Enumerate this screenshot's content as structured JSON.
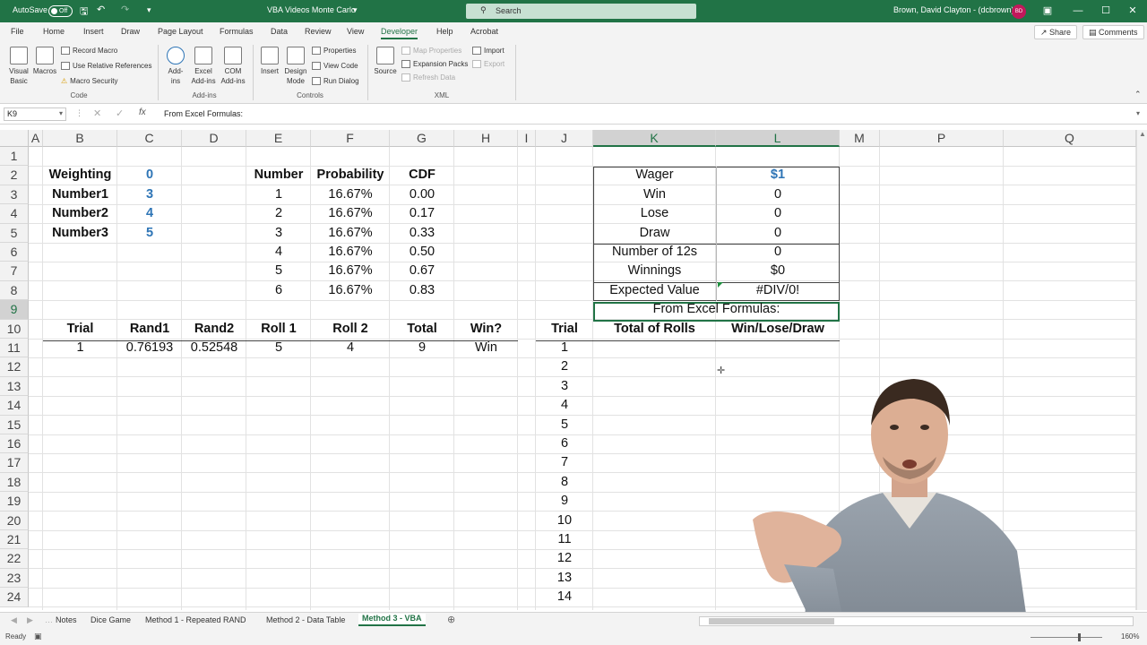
{
  "titlebar": {
    "autosave_label": "AutoSave",
    "autosave_state": "Off",
    "file_title": "VBA Videos Monte Carlo",
    "search_placeholder": "Search",
    "user_name": "Brown, David Clayton - (dcbrown)",
    "user_initials": "BD"
  },
  "menu": {
    "tabs": [
      "File",
      "Home",
      "Insert",
      "Draw",
      "Page Layout",
      "Formulas",
      "Data",
      "Review",
      "View",
      "Developer",
      "Help",
      "Acrobat"
    ],
    "active_tab": "Developer",
    "share_label": "Share",
    "comments_label": "Comments"
  },
  "ribbon": {
    "code": {
      "group_label": "Code",
      "visual_basic": "Visual Basic",
      "macros": "Macros",
      "record_macro": "Record Macro",
      "relative_refs": "Use Relative References",
      "macro_security": "Macro Security"
    },
    "addins": {
      "group_label": "Add-ins",
      "addins": "Add-ins",
      "excel_addins": "Excel Add-ins",
      "com_addins": "COM Add-ins"
    },
    "controls": {
      "group_label": "Controls",
      "insert": "Insert",
      "design_mode": "Design Mode",
      "properties": "Properties",
      "view_code": "View Code",
      "run_dialog": "Run Dialog"
    },
    "xml": {
      "group_label": "XML",
      "source": "Source",
      "map_properties": "Map Properties",
      "expansion_packs": "Expansion Packs",
      "refresh_data": "Refresh Data",
      "import": "Import",
      "export": "Export"
    }
  },
  "formula_bar": {
    "name_box": "K9",
    "fx": "fx",
    "value": "From Excel Formulas:"
  },
  "columns": [
    "A",
    "B",
    "C",
    "D",
    "E",
    "F",
    "G",
    "H",
    "I",
    "J",
    "K",
    "L",
    "M",
    "P",
    "Q"
  ],
  "rows": [
    "1",
    "2",
    "3",
    "4",
    "5",
    "6",
    "7",
    "8",
    "9",
    "10",
    "11",
    "12",
    "13",
    "14",
    "15",
    "16",
    "17",
    "18",
    "19",
    "20",
    "21",
    "22",
    "23",
    "24"
  ],
  "cells": {
    "B2": "Weighting",
    "C2": "0",
    "B3": "Number1",
    "C3": "3",
    "B4": "Number2",
    "C4": "4",
    "B5": "Number3",
    "C5": "5",
    "E2": "Number",
    "F2": "Probability",
    "G2": "CDF",
    "E3": "1",
    "F3": "16.67%",
    "G3": "0.00",
    "E4": "2",
    "F4": "16.67%",
    "G4": "0.17",
    "E5": "3",
    "F5": "16.67%",
    "G5": "0.33",
    "E6": "4",
    "F6": "16.67%",
    "G6": "0.50",
    "E7": "5",
    "F7": "16.67%",
    "G7": "0.67",
    "E8": "6",
    "F8": "16.67%",
    "G8": "0.83",
    "K2": "Wager",
    "L2": "$1",
    "K3": "Win",
    "L3": "0",
    "K4": "Lose",
    "L4": "0",
    "K5": "Draw",
    "L5": "0",
    "K6": "Number of 12s",
    "L6": "0",
    "K7": "Winnings",
    "L7": "$0",
    "K8": "Expected Value",
    "L8": "#DIV/0!",
    "K9": "From Excel Formulas:",
    "B10": "Trial",
    "C10": "Rand1",
    "D10": "Rand2",
    "E10": "Roll 1",
    "F10": "Roll 2",
    "G10": "Total",
    "H10": "Win?",
    "J10": "Trial",
    "K10": "Total of Rolls",
    "L10": "Win/Lose/Draw",
    "B11": "1",
    "C11": "0.76193",
    "D11": "0.52548",
    "E11": "5",
    "F11": "4",
    "G11": "9",
    "H11": "Win",
    "J11": "1",
    "J12": "2",
    "J13": "3",
    "J14": "4",
    "J15": "5",
    "J16": "6",
    "J17": "7",
    "J18": "8",
    "J19": "9",
    "J20": "10",
    "J21": "11",
    "J22": "12",
    "J23": "13",
    "J24": "14"
  },
  "sheet_tabs": [
    "Notes",
    "Dice Game",
    "Method 1 - Repeated RAND",
    "Method 2 - Data Table",
    "Method 3 - VBA"
  ],
  "active_sheet": "Method 3 - VBA",
  "status": {
    "ready": "Ready",
    "zoom": "160%"
  },
  "colors": {
    "excel_green": "#217346",
    "input_blue": "#2e75b6"
  }
}
